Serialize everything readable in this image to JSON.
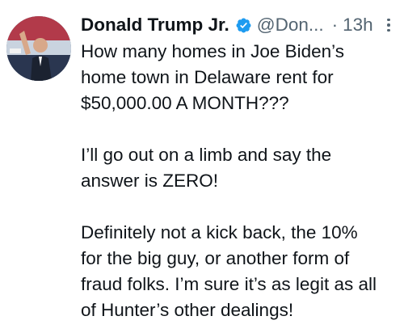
{
  "tweet": {
    "author_name": "Donald Trump Jr.",
    "handle": "@Don...",
    "separator": "·",
    "time": "13h",
    "verified_color": "#1d9bf0",
    "icons": {
      "verified": "verified-badge-icon",
      "more": "more-options-icon"
    },
    "paragraphs": [
      [
        "How many homes in Joe Biden’s",
        "home town in Delaware rent for",
        "$50,000.00 A MONTH???"
      ],
      [
        "I’ll go out on a limb and say the",
        "answer is ZERO!"
      ],
      [
        "Definitely not a kick back, the 10%",
        "for the big guy, or another form of",
        "fraud folks. I’m sure it’s as legit as all",
        "of Hunter’s other dealings!"
      ]
    ]
  }
}
